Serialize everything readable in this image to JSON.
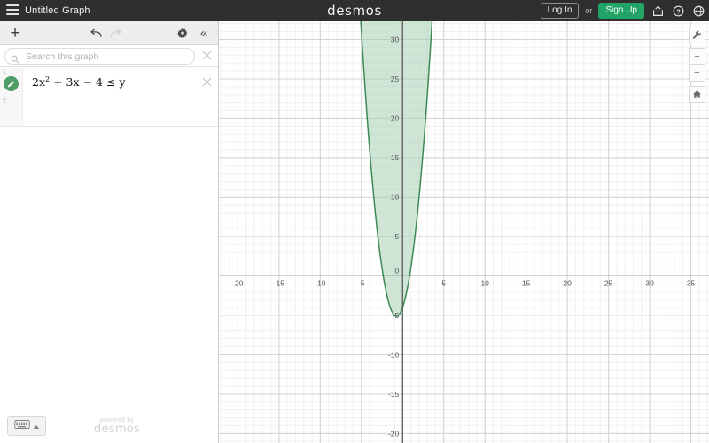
{
  "header": {
    "menu_icon": "hamburger-menu-icon",
    "doc_title": "Untitled Graph",
    "brand": "desmos",
    "login_label": "Log In",
    "or_label": "or",
    "signup_label": "Sign Up",
    "share_icon": "share-icon",
    "help_icon": "help-circle-icon",
    "language_icon": "globe-icon",
    "bg_color": "#2f2f2f",
    "signup_color": "#21a366"
  },
  "expression_toolbar": {
    "add_label": "+",
    "add_icon": "plus-icon",
    "undo_icon": "undo-arrow-icon",
    "redo_icon": "redo-arrow-icon",
    "settings_icon": "gear-icon",
    "collapse_label": "«",
    "collapse_icon": "chevron-double-left-icon"
  },
  "search": {
    "placeholder": "Search this graph",
    "value": "",
    "icon": "search-icon",
    "close_icon": "close-x-icon"
  },
  "expressions": [
    {
      "row_number": "1",
      "color": "#4f9e68",
      "lhs": "2x",
      "exponent": "2",
      "rest": " + 3x − 4 ≤ y",
      "full_text": "2x² + 3x − 4 ≤ y",
      "delete_icon": "close-x-icon"
    },
    {
      "row_number": "2",
      "color": "",
      "lhs": "",
      "exponent": "",
      "rest": "",
      "full_text": "",
      "delete_icon": ""
    }
  ],
  "footer": {
    "keypad_icon": "keyboard-icon",
    "keypad_caret_icon": "caret-up-icon",
    "powered_by_line1": "powered by",
    "powered_by_line2": "desmos"
  },
  "graph_tools": [
    {
      "name": "graph-settings-wrench",
      "icon": "wrench-icon",
      "label": ""
    },
    {
      "name": "zoom-in",
      "icon": "plus-icon",
      "label": "+"
    },
    {
      "name": "zoom-out",
      "icon": "minus-icon",
      "label": "−"
    },
    {
      "name": "zoom-default-home",
      "icon": "home-icon",
      "label": ""
    }
  ],
  "chart_data": {
    "type": "line",
    "title": "",
    "xlabel": "",
    "ylabel": "",
    "expression": "2x^2 + 3x - 4 <= y",
    "relation": "≤",
    "shade": "above",
    "curve_color": "#3d8a56",
    "fill_color": "#a8cfb4",
    "fill_opacity": 0.55,
    "grid": true,
    "minor_grid_step": 1,
    "major_grid_step": 5,
    "xlim": [
      -22.3,
      37.2
    ],
    "ylim": [
      -21.2,
      32.3
    ],
    "xticks": [
      -20,
      -15,
      -10,
      -5,
      0,
      5,
      10,
      15,
      20,
      25,
      30,
      35
    ],
    "xtick_labels": [
      "-20",
      "-15",
      "-10",
      "-5",
      "0",
      "5",
      "10",
      "15",
      "20",
      "25",
      "30",
      "35"
    ],
    "yticks": [
      -20,
      -15,
      -10,
      -5,
      0,
      5,
      10,
      15,
      20,
      25,
      30
    ],
    "ytick_labels": [
      "-20",
      "-15",
      "-10",
      "-5",
      "0",
      "5",
      "10",
      "15",
      "20",
      "25",
      "30"
    ],
    "vertex": [
      -0.75,
      -5.125
    ],
    "roots": [
      -2.637,
      1.137
    ],
    "y_intercept": -4,
    "coefficients": {
      "a": 2,
      "b": 3,
      "c": -4
    },
    "points": [
      [
        -4.5,
        23.0
      ],
      [
        -4.25,
        19.4
      ],
      [
        -4.0,
        16.0
      ],
      [
        -3.75,
        12.9
      ],
      [
        -3.5,
        10.0
      ],
      [
        -3.25,
        7.4
      ],
      [
        -3.0,
        5.0
      ],
      [
        -2.75,
        2.9
      ],
      [
        -2.5,
        1.0
      ],
      [
        -2.25,
        -0.6
      ],
      [
        -2.0,
        -2.0
      ],
      [
        -1.75,
        -3.1
      ],
      [
        -1.5,
        -4.0
      ],
      [
        -1.25,
        -4.6
      ],
      [
        -1.0,
        -5.0
      ],
      [
        -0.75,
        -5.125
      ],
      [
        -0.5,
        -5.0
      ],
      [
        -0.25,
        -4.6
      ],
      [
        0.0,
        -4.0
      ],
      [
        0.25,
        -3.1
      ],
      [
        0.5,
        -2.0
      ],
      [
        0.75,
        -0.6
      ],
      [
        1.0,
        1.0
      ],
      [
        1.25,
        2.9
      ],
      [
        1.5,
        5.0
      ],
      [
        1.75,
        7.4
      ],
      [
        2.0,
        10.0
      ],
      [
        2.25,
        12.9
      ],
      [
        2.5,
        16.0
      ],
      [
        2.75,
        19.4
      ],
      [
        3.0,
        23.0
      ],
      [
        3.25,
        26.9
      ],
      [
        3.5,
        31.0
      ],
      [
        3.6,
        32.7
      ]
    ]
  }
}
